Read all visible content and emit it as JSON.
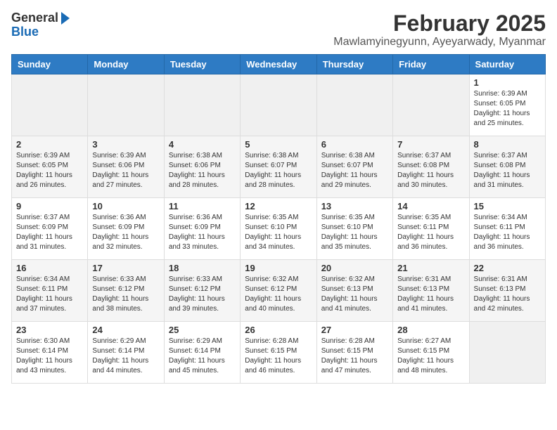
{
  "header": {
    "logo_general": "General",
    "logo_blue": "Blue",
    "month_year": "February 2025",
    "location": "Mawlamyinegyunn, Ayeyarwady, Myanmar"
  },
  "days_of_week": [
    "Sunday",
    "Monday",
    "Tuesday",
    "Wednesday",
    "Thursday",
    "Friday",
    "Saturday"
  ],
  "weeks": [
    [
      {
        "day": "",
        "info": ""
      },
      {
        "day": "",
        "info": ""
      },
      {
        "day": "",
        "info": ""
      },
      {
        "day": "",
        "info": ""
      },
      {
        "day": "",
        "info": ""
      },
      {
        "day": "",
        "info": ""
      },
      {
        "day": "1",
        "info": "Sunrise: 6:39 AM\nSunset: 6:05 PM\nDaylight: 11 hours\nand 25 minutes."
      }
    ],
    [
      {
        "day": "2",
        "info": "Sunrise: 6:39 AM\nSunset: 6:05 PM\nDaylight: 11 hours\nand 26 minutes."
      },
      {
        "day": "3",
        "info": "Sunrise: 6:39 AM\nSunset: 6:06 PM\nDaylight: 11 hours\nand 27 minutes."
      },
      {
        "day": "4",
        "info": "Sunrise: 6:38 AM\nSunset: 6:06 PM\nDaylight: 11 hours\nand 28 minutes."
      },
      {
        "day": "5",
        "info": "Sunrise: 6:38 AM\nSunset: 6:07 PM\nDaylight: 11 hours\nand 28 minutes."
      },
      {
        "day": "6",
        "info": "Sunrise: 6:38 AM\nSunset: 6:07 PM\nDaylight: 11 hours\nand 29 minutes."
      },
      {
        "day": "7",
        "info": "Sunrise: 6:37 AM\nSunset: 6:08 PM\nDaylight: 11 hours\nand 30 minutes."
      },
      {
        "day": "8",
        "info": "Sunrise: 6:37 AM\nSunset: 6:08 PM\nDaylight: 11 hours\nand 31 minutes."
      }
    ],
    [
      {
        "day": "9",
        "info": "Sunrise: 6:37 AM\nSunset: 6:09 PM\nDaylight: 11 hours\nand 31 minutes."
      },
      {
        "day": "10",
        "info": "Sunrise: 6:36 AM\nSunset: 6:09 PM\nDaylight: 11 hours\nand 32 minutes."
      },
      {
        "day": "11",
        "info": "Sunrise: 6:36 AM\nSunset: 6:09 PM\nDaylight: 11 hours\nand 33 minutes."
      },
      {
        "day": "12",
        "info": "Sunrise: 6:35 AM\nSunset: 6:10 PM\nDaylight: 11 hours\nand 34 minutes."
      },
      {
        "day": "13",
        "info": "Sunrise: 6:35 AM\nSunset: 6:10 PM\nDaylight: 11 hours\nand 35 minutes."
      },
      {
        "day": "14",
        "info": "Sunrise: 6:35 AM\nSunset: 6:11 PM\nDaylight: 11 hours\nand 36 minutes."
      },
      {
        "day": "15",
        "info": "Sunrise: 6:34 AM\nSunset: 6:11 PM\nDaylight: 11 hours\nand 36 minutes."
      }
    ],
    [
      {
        "day": "16",
        "info": "Sunrise: 6:34 AM\nSunset: 6:11 PM\nDaylight: 11 hours\nand 37 minutes."
      },
      {
        "day": "17",
        "info": "Sunrise: 6:33 AM\nSunset: 6:12 PM\nDaylight: 11 hours\nand 38 minutes."
      },
      {
        "day": "18",
        "info": "Sunrise: 6:33 AM\nSunset: 6:12 PM\nDaylight: 11 hours\nand 39 minutes."
      },
      {
        "day": "19",
        "info": "Sunrise: 6:32 AM\nSunset: 6:12 PM\nDaylight: 11 hours\nand 40 minutes."
      },
      {
        "day": "20",
        "info": "Sunrise: 6:32 AM\nSunset: 6:13 PM\nDaylight: 11 hours\nand 41 minutes."
      },
      {
        "day": "21",
        "info": "Sunrise: 6:31 AM\nSunset: 6:13 PM\nDaylight: 11 hours\nand 41 minutes."
      },
      {
        "day": "22",
        "info": "Sunrise: 6:31 AM\nSunset: 6:13 PM\nDaylight: 11 hours\nand 42 minutes."
      }
    ],
    [
      {
        "day": "23",
        "info": "Sunrise: 6:30 AM\nSunset: 6:14 PM\nDaylight: 11 hours\nand 43 minutes."
      },
      {
        "day": "24",
        "info": "Sunrise: 6:29 AM\nSunset: 6:14 PM\nDaylight: 11 hours\nand 44 minutes."
      },
      {
        "day": "25",
        "info": "Sunrise: 6:29 AM\nSunset: 6:14 PM\nDaylight: 11 hours\nand 45 minutes."
      },
      {
        "day": "26",
        "info": "Sunrise: 6:28 AM\nSunset: 6:15 PM\nDaylight: 11 hours\nand 46 minutes."
      },
      {
        "day": "27",
        "info": "Sunrise: 6:28 AM\nSunset: 6:15 PM\nDaylight: 11 hours\nand 47 minutes."
      },
      {
        "day": "28",
        "info": "Sunrise: 6:27 AM\nSunset: 6:15 PM\nDaylight: 11 hours\nand 48 minutes."
      },
      {
        "day": "",
        "info": ""
      }
    ]
  ]
}
